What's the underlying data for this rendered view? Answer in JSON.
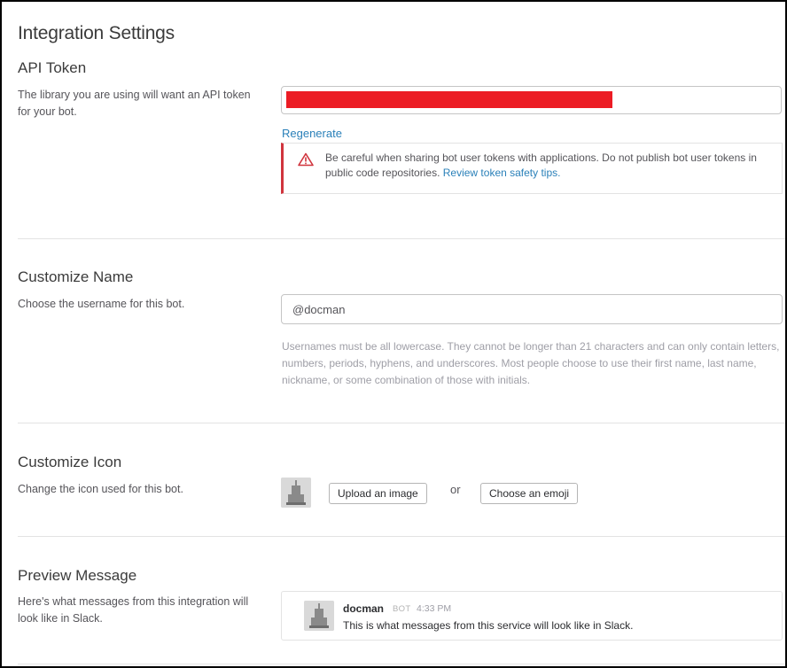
{
  "page": {
    "title": "Integration Settings"
  },
  "api_token": {
    "heading": "API Token",
    "description": "The library you are using will want an API token for your bot.",
    "regenerate_label": "Regenerate",
    "warning_text": "Be careful when sharing bot user tokens with applications. Do not publish bot user tokens in public code repositories.",
    "warning_link": "Review token safety tips."
  },
  "customize_name": {
    "heading": "Customize Name",
    "description": "Choose the username for this bot.",
    "username_value": "@docman",
    "hint": "Usernames must be all lowercase. They cannot be longer than 21 characters and can only contain letters, numbers, periods, hyphens, and underscores. Most people choose to use their first name, last name, nickname, or some combination of those with initials."
  },
  "customize_icon": {
    "heading": "Customize Icon",
    "description": "Change the icon used for this bot.",
    "upload_label": "Upload an image",
    "or_label": "or",
    "emoji_label": "Choose an emoji"
  },
  "preview_message": {
    "heading": "Preview Message",
    "description": "Here's what messages from this integration will look like in Slack.",
    "bot_name": "docman",
    "badge": "BOT",
    "time": "4:33 PM",
    "text": "This is what messages from this service will look like in Slack."
  },
  "colors": {
    "link": "#2a80b9",
    "warning_accent": "#d0343d",
    "token_mask": "#ec1c24"
  },
  "icons": {
    "warning": "warning-triangle-icon",
    "bot_avatar": "bot-avatar-icon"
  }
}
